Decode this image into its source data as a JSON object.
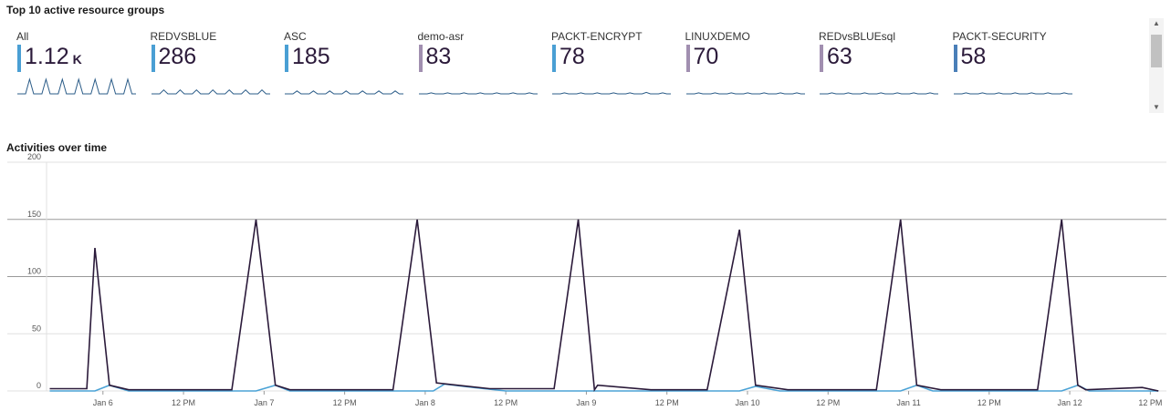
{
  "top_groups": {
    "title": "Top 10 active resource groups",
    "tiles": [
      {
        "name": "All",
        "value": "1.12",
        "unit": "K",
        "bar_color": "#4a9fd4",
        "spark": [
          0,
          0,
          0,
          15,
          0,
          0,
          0,
          15,
          0,
          0,
          0,
          15,
          0,
          0,
          0,
          15,
          0,
          0,
          0,
          15,
          0,
          0,
          0,
          15,
          0,
          0,
          0,
          15,
          0,
          0
        ]
      },
      {
        "name": "REDVSBLUE",
        "value": "286",
        "bar_color": "#4a9fd4",
        "spark": [
          0,
          0,
          0,
          4,
          0,
          0,
          0,
          4,
          0,
          0,
          0,
          4,
          0,
          0,
          0,
          4,
          0,
          0,
          0,
          4,
          0,
          0,
          0,
          4,
          0,
          0,
          0,
          4,
          0,
          0
        ]
      },
      {
        "name": "ASC",
        "value": "185",
        "bar_color": "#4a9fd4",
        "spark": [
          0,
          0,
          0,
          3,
          0,
          0,
          0,
          3,
          0,
          0,
          0,
          3,
          0,
          0,
          0,
          3,
          0,
          0,
          0,
          3,
          0,
          0,
          0,
          3,
          0,
          0,
          0,
          3,
          0,
          0
        ]
      },
      {
        "name": "demo-asr",
        "value": "83",
        "bar_color": "#a18fb0",
        "spark": [
          0,
          0,
          0,
          1,
          0,
          0,
          0,
          1,
          0,
          0,
          0,
          1,
          0,
          0,
          0,
          1,
          0,
          0,
          0,
          1,
          0,
          0,
          0,
          1,
          0,
          0,
          0,
          1,
          0,
          0
        ]
      },
      {
        "name": "PACKT-ENCRYPT",
        "value": "78",
        "bar_color": "#4a9fd4",
        "spark": [
          0,
          0,
          0,
          1,
          0,
          0,
          0,
          1,
          0,
          0,
          0,
          1,
          0,
          0,
          0,
          1,
          0,
          0,
          0,
          1,
          0,
          0,
          0,
          1.5,
          0,
          0,
          0,
          1,
          0,
          0
        ]
      },
      {
        "name": "LINUXDEMO",
        "value": "70",
        "bar_color": "#a18fb0",
        "spark": [
          0,
          0,
          0,
          1,
          0,
          0,
          0,
          1,
          0,
          0,
          0,
          1,
          0,
          0,
          0,
          1,
          0,
          0,
          0,
          1,
          0,
          0,
          0,
          1,
          0,
          0,
          0,
          1,
          0,
          0
        ]
      },
      {
        "name": "REDvsBLUEsql",
        "value": "63",
        "bar_color": "#a18fb0",
        "spark": [
          0,
          0,
          0,
          1,
          0,
          0,
          0,
          1,
          0,
          0,
          0,
          1,
          0,
          0,
          0,
          1,
          0,
          0,
          0,
          1,
          0,
          0,
          0,
          1,
          0,
          0,
          0,
          1,
          0,
          0
        ]
      },
      {
        "name": "PACKT-SECURITY",
        "value": "58",
        "bar_color": "#4a7fb8",
        "spark": [
          0,
          0,
          0,
          1,
          0,
          0,
          0,
          1,
          0,
          0,
          0,
          1,
          0,
          0,
          0,
          1,
          0,
          0,
          0,
          1,
          0,
          0,
          0,
          1,
          0,
          0,
          0,
          1,
          0,
          0
        ]
      }
    ]
  },
  "scrollbar": {
    "up_icon": "▲",
    "down_icon": "▼"
  },
  "chart_data": {
    "type": "line",
    "title": "Activities over time",
    "xlabel": "",
    "ylabel": "",
    "ylim": [
      0,
      200
    ],
    "xlim": [
      -0.35,
      6.6
    ],
    "y_ticks": [
      0,
      50,
      100,
      150,
      200
    ],
    "x_ticks": [
      {
        "x": 0,
        "label": "Jan 6"
      },
      {
        "x": 0.5,
        "label": "12 PM"
      },
      {
        "x": 1,
        "label": "Jan 7"
      },
      {
        "x": 1.5,
        "label": "12 PM"
      },
      {
        "x": 2,
        "label": "Jan 8"
      },
      {
        "x": 2.5,
        "label": "12 PM"
      },
      {
        "x": 3,
        "label": "Jan 9"
      },
      {
        "x": 3.5,
        "label": "12 PM"
      },
      {
        "x": 4,
        "label": "Jan 10"
      },
      {
        "x": 4.5,
        "label": "12 PM"
      },
      {
        "x": 5,
        "label": "Jan 11"
      },
      {
        "x": 5.5,
        "label": "12 PM"
      },
      {
        "x": 6,
        "label": "Jan 12"
      },
      {
        "x": 6.5,
        "label": "12 PM"
      }
    ],
    "grid": true,
    "series": [
      {
        "color": "#2b1a3a",
        "points": [
          [
            -0.33,
            2
          ],
          [
            -0.1,
            2
          ],
          [
            -0.05,
            125
          ],
          [
            0.04,
            5
          ],
          [
            0.16,
            1
          ],
          [
            0.8,
            1
          ],
          [
            0.95,
            150
          ],
          [
            1.07,
            5
          ],
          [
            1.16,
            1
          ],
          [
            1.8,
            1
          ],
          [
            1.95,
            150
          ],
          [
            2.07,
            7
          ],
          [
            2.4,
            2
          ],
          [
            2.8,
            2
          ],
          [
            2.95,
            150
          ],
          [
            3.05,
            1
          ],
          [
            3.07,
            5
          ],
          [
            3.4,
            1
          ],
          [
            3.75,
            1
          ],
          [
            3.95,
            141
          ],
          [
            4.05,
            5
          ],
          [
            4.25,
            1
          ],
          [
            4.8,
            1
          ],
          [
            4.95,
            150
          ],
          [
            5.05,
            5
          ],
          [
            5.2,
            1
          ],
          [
            5.8,
            1
          ],
          [
            5.95,
            150
          ],
          [
            6.05,
            5
          ],
          [
            6.1,
            1
          ],
          [
            6.45,
            3
          ],
          [
            6.55,
            0
          ]
        ]
      },
      {
        "color": "#4ba3d6",
        "points": [
          [
            -0.33,
            0
          ],
          [
            -0.05,
            0
          ],
          [
            0.04,
            5
          ],
          [
            0.16,
            0
          ],
          [
            0.95,
            0
          ],
          [
            1.07,
            5
          ],
          [
            1.16,
            0
          ],
          [
            2.05,
            0
          ],
          [
            2.12,
            6
          ],
          [
            2.3,
            3
          ],
          [
            2.5,
            0
          ],
          [
            3.95,
            0
          ],
          [
            4.05,
            4
          ],
          [
            4.2,
            0
          ],
          [
            4.95,
            0
          ],
          [
            5.05,
            5
          ],
          [
            5.15,
            0
          ],
          [
            5.95,
            0
          ],
          [
            6.05,
            5
          ],
          [
            6.12,
            0
          ],
          [
            6.55,
            0
          ]
        ]
      }
    ]
  }
}
